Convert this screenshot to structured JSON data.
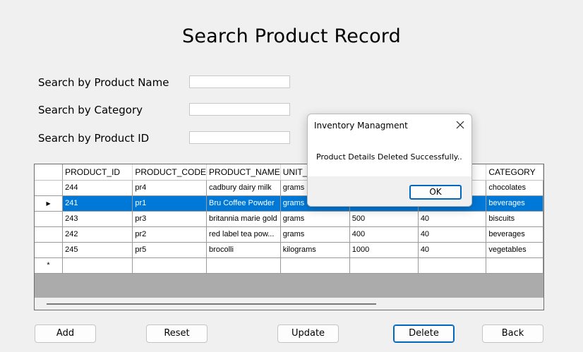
{
  "page": {
    "title": "Search Product Record"
  },
  "search": {
    "name_label": "Search by Product Name",
    "category_label": "Search by Category",
    "id_label": "Search by Product ID",
    "name_value": "",
    "category_value": "",
    "id_value": ""
  },
  "grid": {
    "columns": [
      "PRODUCT_ID",
      "PRODUCT_CODE",
      "PRODUCT_NAME",
      "UNIT_N",
      "",
      "",
      "CATEGORY"
    ],
    "rows": [
      [
        "244",
        "pr4",
        "cadbury dairy milk",
        "grams",
        "",
        "",
        "chocolates"
      ],
      [
        "241",
        "pr1",
        "Bru Coffee Powder",
        "grams",
        "",
        "",
        "beverages"
      ],
      [
        "243",
        "pr3",
        "britannia marie gold",
        "grams",
        "500",
        "40",
        "biscuits"
      ],
      [
        "242",
        "pr2",
        "red label tea pow...",
        "grams",
        "400",
        "40",
        "beverages"
      ],
      [
        "245",
        "pr5",
        "brocolli",
        "kilograms",
        "1000",
        "40",
        "vegetables"
      ]
    ],
    "selected_row_index": 1,
    "current_row_glyph": "▶",
    "new_row_glyph": "*"
  },
  "buttons": {
    "add": "Add",
    "reset": "Reset",
    "update": "Update",
    "delete": "Delete",
    "back": "Back"
  },
  "dialog": {
    "title": "Inventory Managment",
    "message": "Product Details Deleted Successfully..",
    "ok": "OK"
  },
  "colors": {
    "selection": "#0078d7",
    "focus_border": "#0067c0",
    "background": "#f0f0f0"
  }
}
